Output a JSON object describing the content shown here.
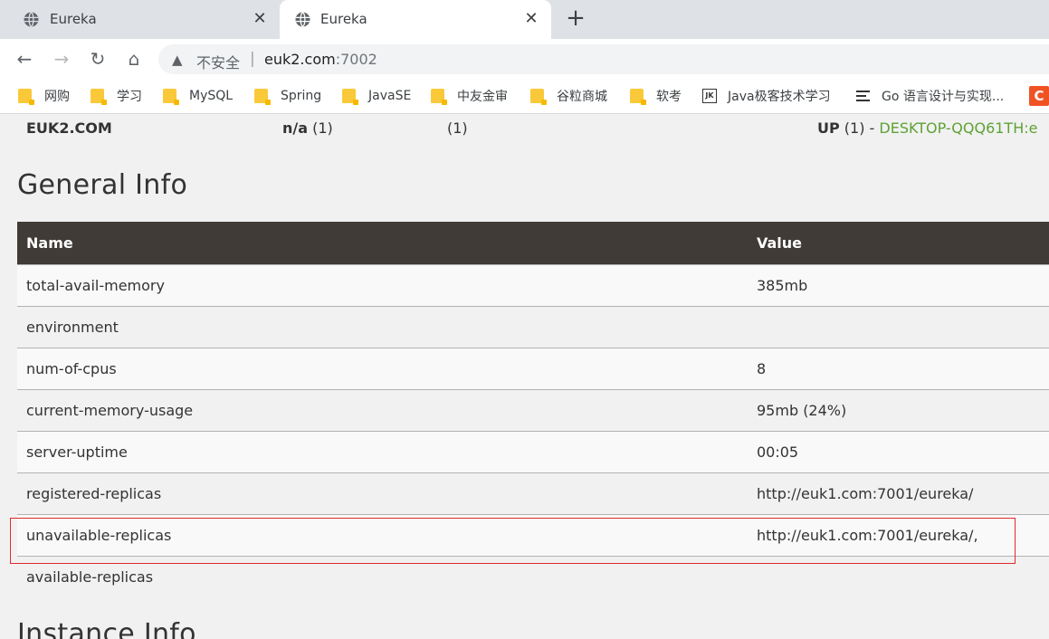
{
  "browser": {
    "tabs": [
      {
        "title": "Eureka",
        "close": "✕"
      },
      {
        "title": "Eureka",
        "close": "✕"
      }
    ],
    "new_tab": "+",
    "nav": {
      "back": "←",
      "forward": "→",
      "reload": "↻",
      "home": "⌂"
    },
    "omnibox": {
      "warning_icon": "▲",
      "security_label": "不安全",
      "separator": "|",
      "host": "euk2.com",
      "port": ":7002"
    },
    "bookmarks": [
      {
        "label": "网购",
        "icon": "folder-icon"
      },
      {
        "label": "学习",
        "icon": "folder-icon"
      },
      {
        "label": "MySQL",
        "icon": "folder-icon"
      },
      {
        "label": "Spring",
        "icon": "folder-icon"
      },
      {
        "label": "JavaSE",
        "icon": "folder-icon"
      },
      {
        "label": "中友金审",
        "icon": "folder-icon"
      },
      {
        "label": "谷粒商城",
        "icon": "folder-icon"
      },
      {
        "label": "软考",
        "icon": "folder-icon"
      },
      {
        "label": "Java极客技术学习",
        "icon": "jk-icon",
        "icon_text": "JK"
      },
      {
        "label": "Go 语言设计与实现...",
        "icon": "list-icon"
      },
      {
        "label": "",
        "icon": "c-badge-icon",
        "icon_text": "C"
      }
    ]
  },
  "page": {
    "ds_replica": {
      "name": "EUK2.COM",
      "ami_bold": "n/a",
      "ami_count": " (1)",
      "az": "(1)",
      "status_bold": "UP",
      "status_count": " (1) - ",
      "instance": "DESKTOP-QQQ61TH:e"
    },
    "general_info": {
      "heading": "General Info",
      "columns": [
        "Name",
        "Value"
      ],
      "rows": [
        {
          "name": "total-avail-memory",
          "value": "385mb"
        },
        {
          "name": "environment",
          "value": ""
        },
        {
          "name": "num-of-cpus",
          "value": "8"
        },
        {
          "name": "current-memory-usage",
          "value": "95mb (24%)"
        },
        {
          "name": "server-uptime",
          "value": "00:05"
        },
        {
          "name": "registered-replicas",
          "value": "http://euk1.com:7001/eureka/"
        },
        {
          "name": "unavailable-replicas",
          "value": "http://euk1.com:7001/eureka/,"
        },
        {
          "name": "available-replicas",
          "value": ""
        }
      ]
    },
    "instance_info": {
      "heading": "Instance Info"
    },
    "highlight_color": "#e02b2b",
    "header_color": "#403b36",
    "instance_link_color": "#5fa134"
  }
}
